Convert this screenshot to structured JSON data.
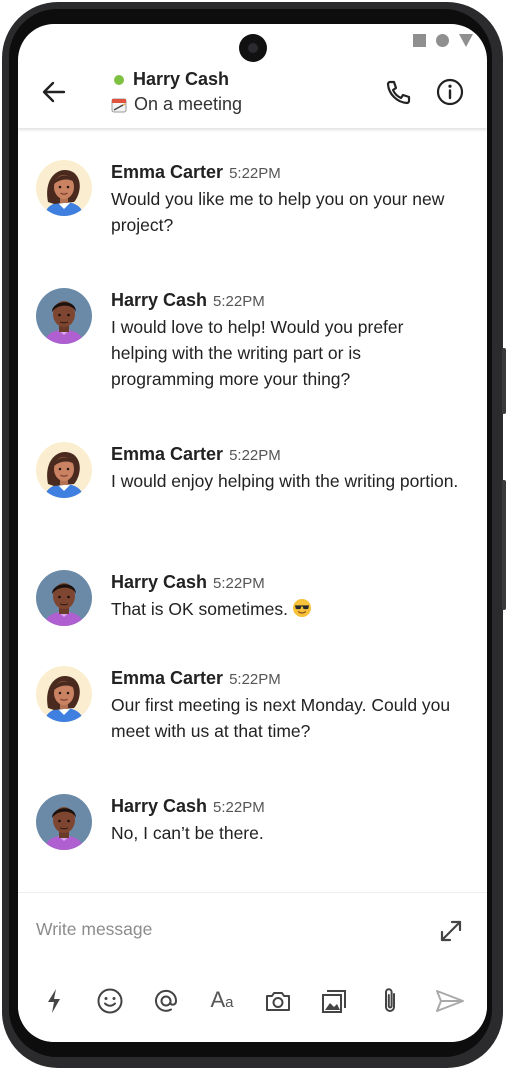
{
  "header": {
    "contact_name": "Harry Cash",
    "status": "On a meeting",
    "online_color": "#7dc142"
  },
  "messages": [
    {
      "sender": "Emma Carter",
      "time": "5:22PM",
      "text": "Would you like me to help you on your new project?"
    },
    {
      "sender": "Harry Cash",
      "time": "5:22PM",
      "text": "I would love to help! Would you prefer helping with the writing part or is programming more your thing?"
    },
    {
      "sender": "Emma Carter",
      "time": "5:22PM",
      "text": "I would enjoy helping with the writing portion."
    },
    {
      "sender": "Harry Cash",
      "time": "5:22PM",
      "text": "That is OK sometimes."
    },
    {
      "sender": "Emma Carter",
      "time": "5:22PM",
      "text": "Our first meeting is next Monday. Could you meet with us at that time?"
    },
    {
      "sender": "Harry Cash",
      "time": "5:22PM",
      "text": "No, I can’t be there."
    }
  ],
  "composer": {
    "placeholder": "Write message",
    "value": ""
  },
  "toolbar": {
    "text_format_label": "Aa"
  },
  "icons": {
    "back": "arrow-left",
    "call": "phone",
    "info": "info-circle",
    "expand": "expand-diagonal",
    "quick": "lightning-bolt",
    "emoji": "smiley",
    "mention": "at-sign",
    "format": "text-format",
    "camera": "camera",
    "gallery": "image",
    "attach": "paperclip",
    "send": "send-arrow"
  }
}
